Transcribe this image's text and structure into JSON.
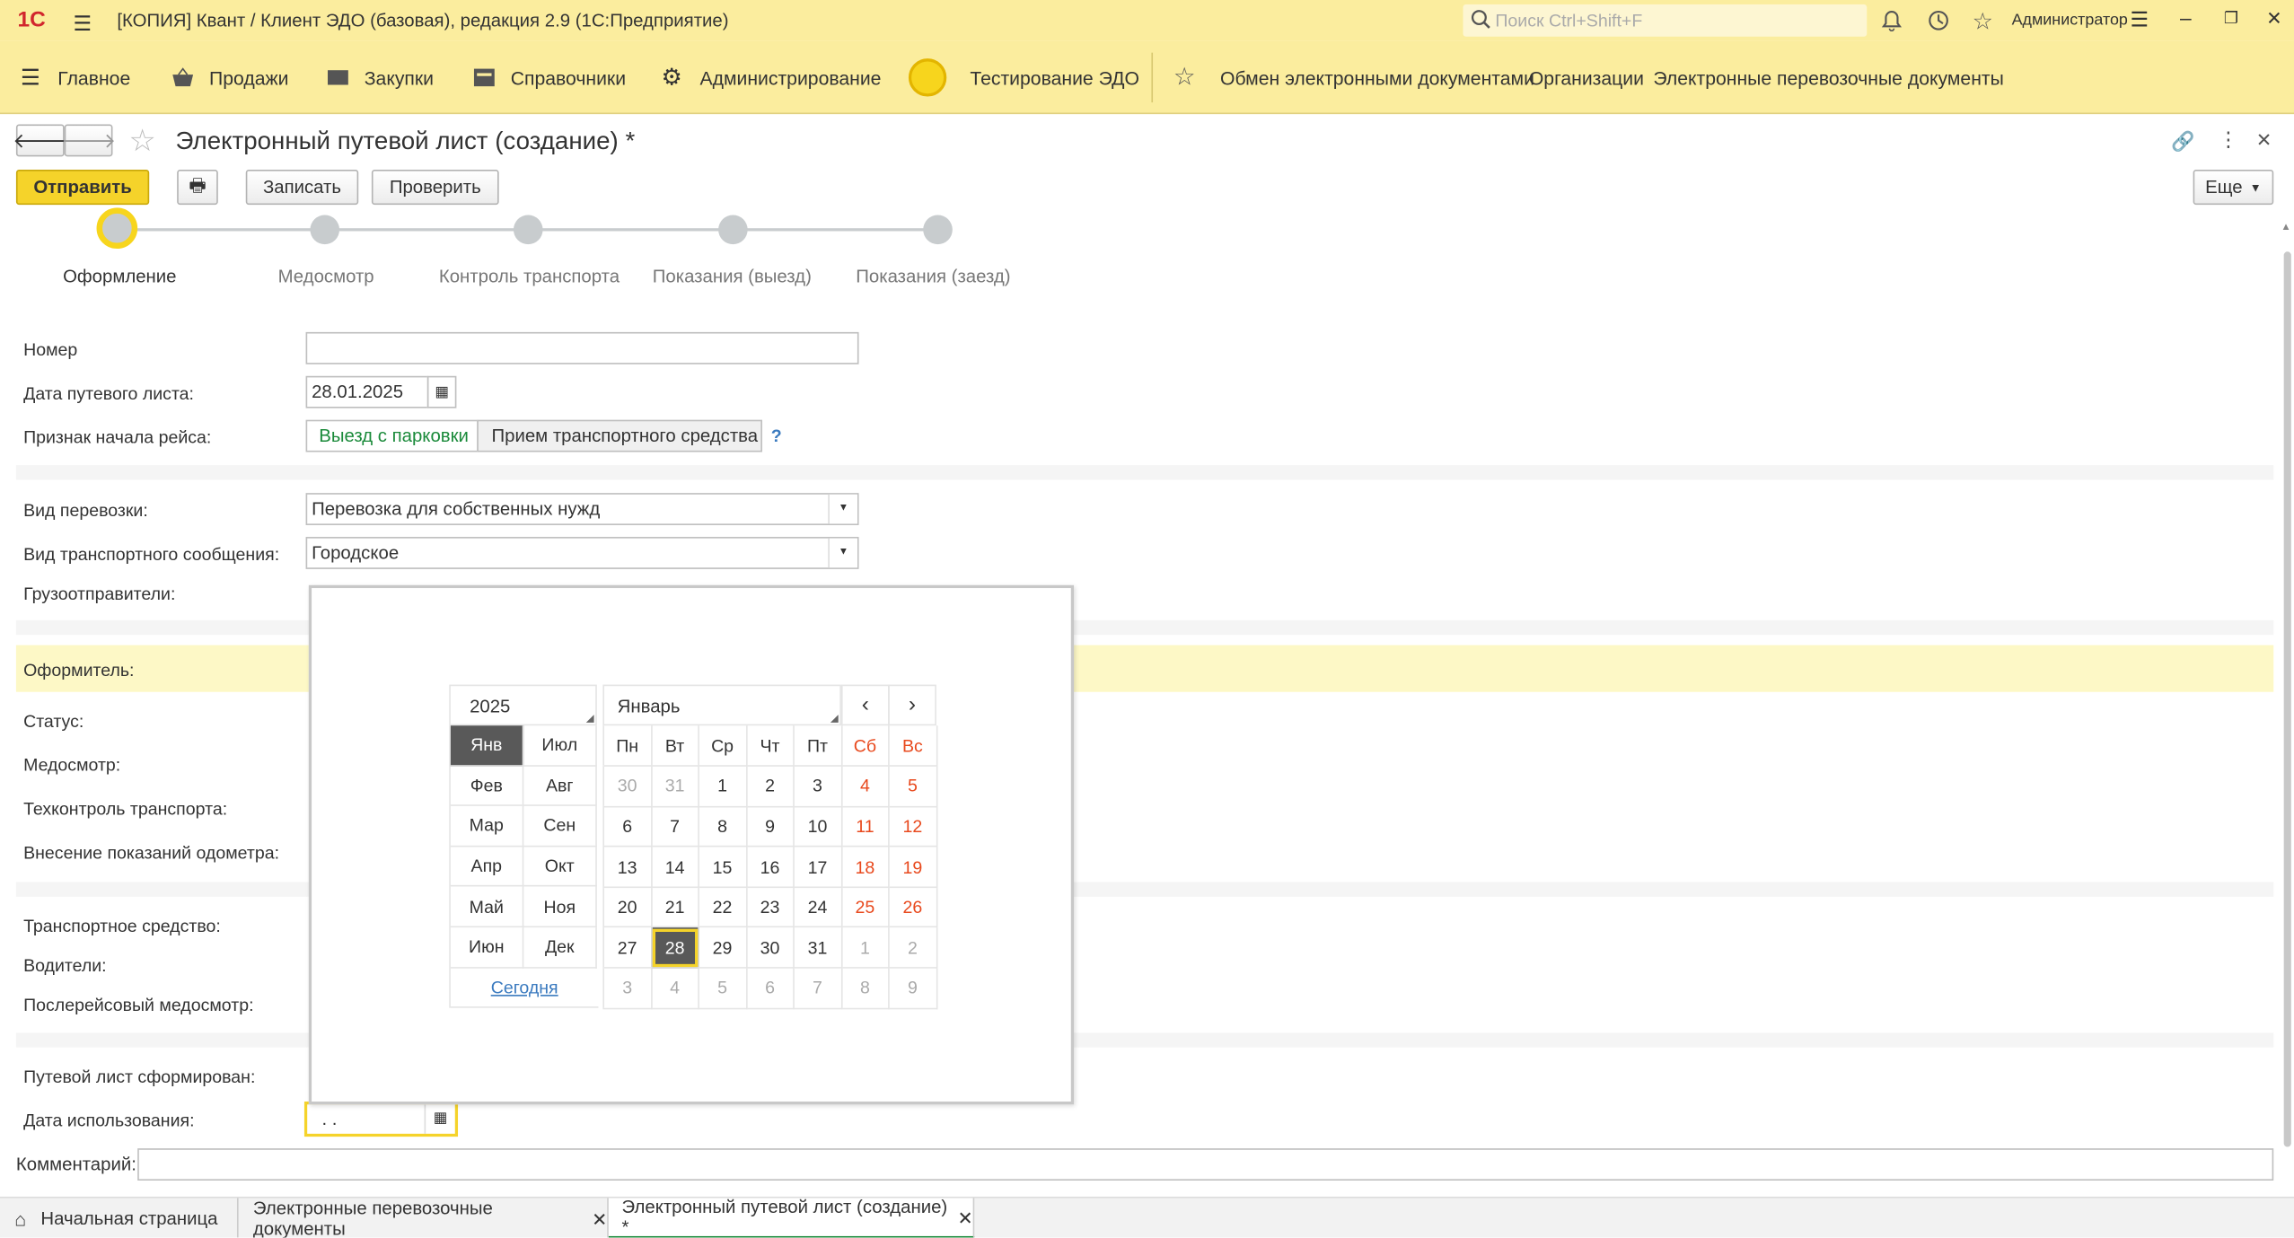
{
  "titlebar": {
    "logo": "1С",
    "title": "[КОПИЯ] Квант / Клиент ЭДО (базовая), редакция 2.9  (1С:Предприятие)",
    "search_placeholder": "Поиск Ctrl+Shift+F",
    "user": "Администратор"
  },
  "menu": {
    "items": [
      "Главное",
      "Продажи",
      "Закупки",
      "Справочники",
      "Администрирование",
      "Тестирование ЭДО"
    ],
    "links": [
      "Обмен электронными документами",
      "Организации",
      "Электронные перевозочные документы"
    ]
  },
  "form": {
    "title": "Электронный путевой лист (создание) *",
    "send": "Отправить",
    "save": "Записать",
    "check": "Проверить",
    "more": "Еще"
  },
  "steps": [
    "Оформление",
    "Медосмотр",
    "Контроль транспорта",
    "Показания (выезд)",
    "Показания (заезд)"
  ],
  "fields": {
    "number_label": "Номер",
    "number_value": "",
    "date_label": "Дата путевого листа:",
    "date_value": "28.01.2025",
    "start_label": "Признак начала рейса:",
    "start_opt1": "Выезд с парковки",
    "start_opt2": "Прием транспортного средства",
    "help": "?",
    "transport_type_label": "Вид перевозки:",
    "transport_type_value": "Перевозка для собственных нужд",
    "connection_label": "Вид транспортного сообщения:",
    "connection_value": "Городское",
    "shippers_label": "Грузоотправители:",
    "author_label": "Оформитель:",
    "status_label": "Статус:",
    "medical_label": "Медосмотр:",
    "techcontrol_label": "Техконтроль транспорта:",
    "odometer_label": "Внесение показаний одометра:",
    "vehicle_label": "Транспортное средство:",
    "drivers_label": "Водители:",
    "post_medical_label": "Послерейсовый медосмотр:",
    "formed_label": "Путевой лист сформирован:",
    "use_date_label": "Дата использования:",
    "use_date_value": " .  .",
    "comment_label": "Комментарий:"
  },
  "calendar": {
    "year": "2025",
    "month": "Январь",
    "months_left": [
      "Янв",
      "Фев",
      "Мар",
      "Апр",
      "Май",
      "Июн"
    ],
    "months_right": [
      "Июл",
      "Авг",
      "Сен",
      "Окт",
      "Ноя",
      "Дек"
    ],
    "weekdays": [
      "Пн",
      "Вт",
      "Ср",
      "Чт",
      "Пт",
      "Сб",
      "Вс"
    ],
    "weeks": [
      [
        "30",
        "31",
        "1",
        "2",
        "3",
        "4",
        "5"
      ],
      [
        "6",
        "7",
        "8",
        "9",
        "10",
        "11",
        "12"
      ],
      [
        "13",
        "14",
        "15",
        "16",
        "17",
        "18",
        "19"
      ],
      [
        "20",
        "21",
        "22",
        "23",
        "24",
        "25",
        "26"
      ],
      [
        "27",
        "28",
        "29",
        "30",
        "31",
        "1",
        "2"
      ],
      [
        "3",
        "4",
        "5",
        "6",
        "7",
        "8",
        "9"
      ]
    ],
    "today": "Сегодня",
    "selected": "28"
  },
  "tabs": [
    "Начальная страница",
    "Электронные перевозочные документы",
    "Электронный путевой лист (создание) *"
  ],
  "colors": {
    "accent": "#fbed9e",
    "button": "#f5d32a",
    "weekend": "#e8491d",
    "link": "#3a7abf",
    "green": "#1a8a3a"
  }
}
